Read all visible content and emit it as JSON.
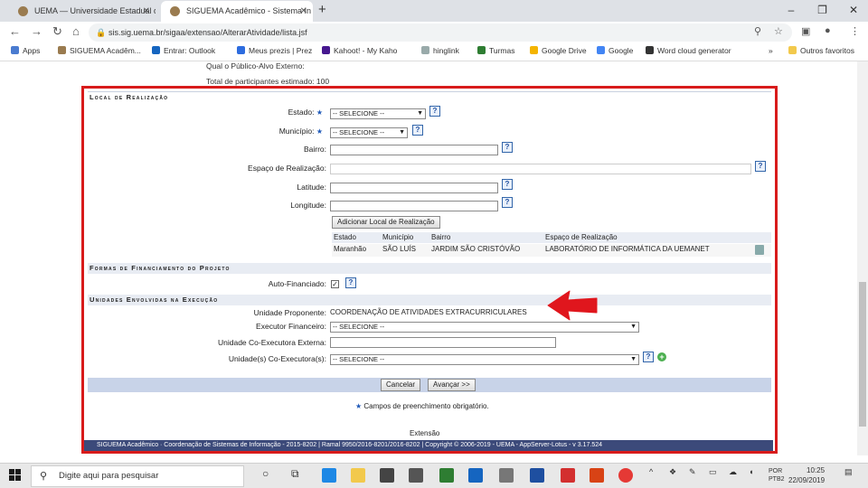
{
  "browser": {
    "tabs": [
      {
        "title": "UEMA — Universidade Estadual d"
      },
      {
        "title": "SIGUEMA Acadêmico - Sistema In"
      }
    ],
    "url": "sis.sig.uema.br/sigaa/extensao/AlterarAtividade/lista.jsf",
    "bookmarks": [
      "Apps",
      "SIGUEMA Acadêm...",
      "Entrar: Outlook",
      "Meus prezis | Prez",
      "Kahoot! - My Kaho",
      "hinglink",
      "Turmas",
      "Google Drive",
      "Google",
      "Word cloud generator"
    ],
    "other_bookmarks": "Outros favoritos"
  },
  "page": {
    "cut_top_1": "Qual o Público-Alvo Externo:",
    "cut_top_2": "Total de participantes estimado: 100",
    "local": {
      "title": "Local de Realização",
      "estado_label": "Estado:",
      "estado_value": "-- SELECIONE --",
      "municipio_label": "Município:",
      "municipio_value": "-- SELECIONE --",
      "bairro_label": "Bairro:",
      "espaco_label": "Espaço de Realização:",
      "latitude_label": "Latitude:",
      "longitude_label": "Longitude:",
      "add_button": "Adicionar Local de Realização",
      "table": {
        "headers": [
          "Estado",
          "Município",
          "Bairro",
          "Espaço de Realização"
        ],
        "row": [
          "Maranhão",
          "SÃO LUÍS",
          "JARDIM SÃO CRISTÓVÃO",
          "LABORATÓRIO DE INFORMÁTICA DA UEMANET"
        ]
      }
    },
    "financiamento": {
      "title": "Formas de Financiamento do Projeto",
      "auto_label": "Auto-Financiado:"
    },
    "unidades": {
      "title": "Unidades Envolvidas na Execução",
      "proponente_label": "Unidade Proponente:",
      "proponente_value": "COORDENAÇÃO DE ATIVIDADES EXTRACURRICULARES",
      "executor_label": "Executor Financeiro:",
      "executor_value": "-- SELECIONE --",
      "externa_label": "Unidade Co-Executora Externa:",
      "coexec_label": "Unidade(s) Co-Executora(s):",
      "coexec_value": "-- SELECIONE --"
    },
    "buttons": {
      "cancel": "Cancelar",
      "next": "Avançar >>"
    },
    "required_note": "Campos de preenchimento obrigatório.",
    "extensao": "Extensão",
    "footer": "SIGUEMA Acadêmico · Coordenação de Sistemas de Informação - 2015-8202 | Ramal 9950/2016-8201/2016-8202 | Copyright © 2006-2019 - UEMA - AppServer-Lotus - v 3.17.524"
  },
  "taskbar": {
    "search_placeholder": "Digite aqui para pesquisar",
    "lang": "POR\nPTB2",
    "time": "10:25",
    "date": "22/09/2019"
  },
  "colors": {
    "highlight_frame": "#d81b1b",
    "arrow": "#e0161d",
    "footer_bg": "#3c4a7a"
  }
}
